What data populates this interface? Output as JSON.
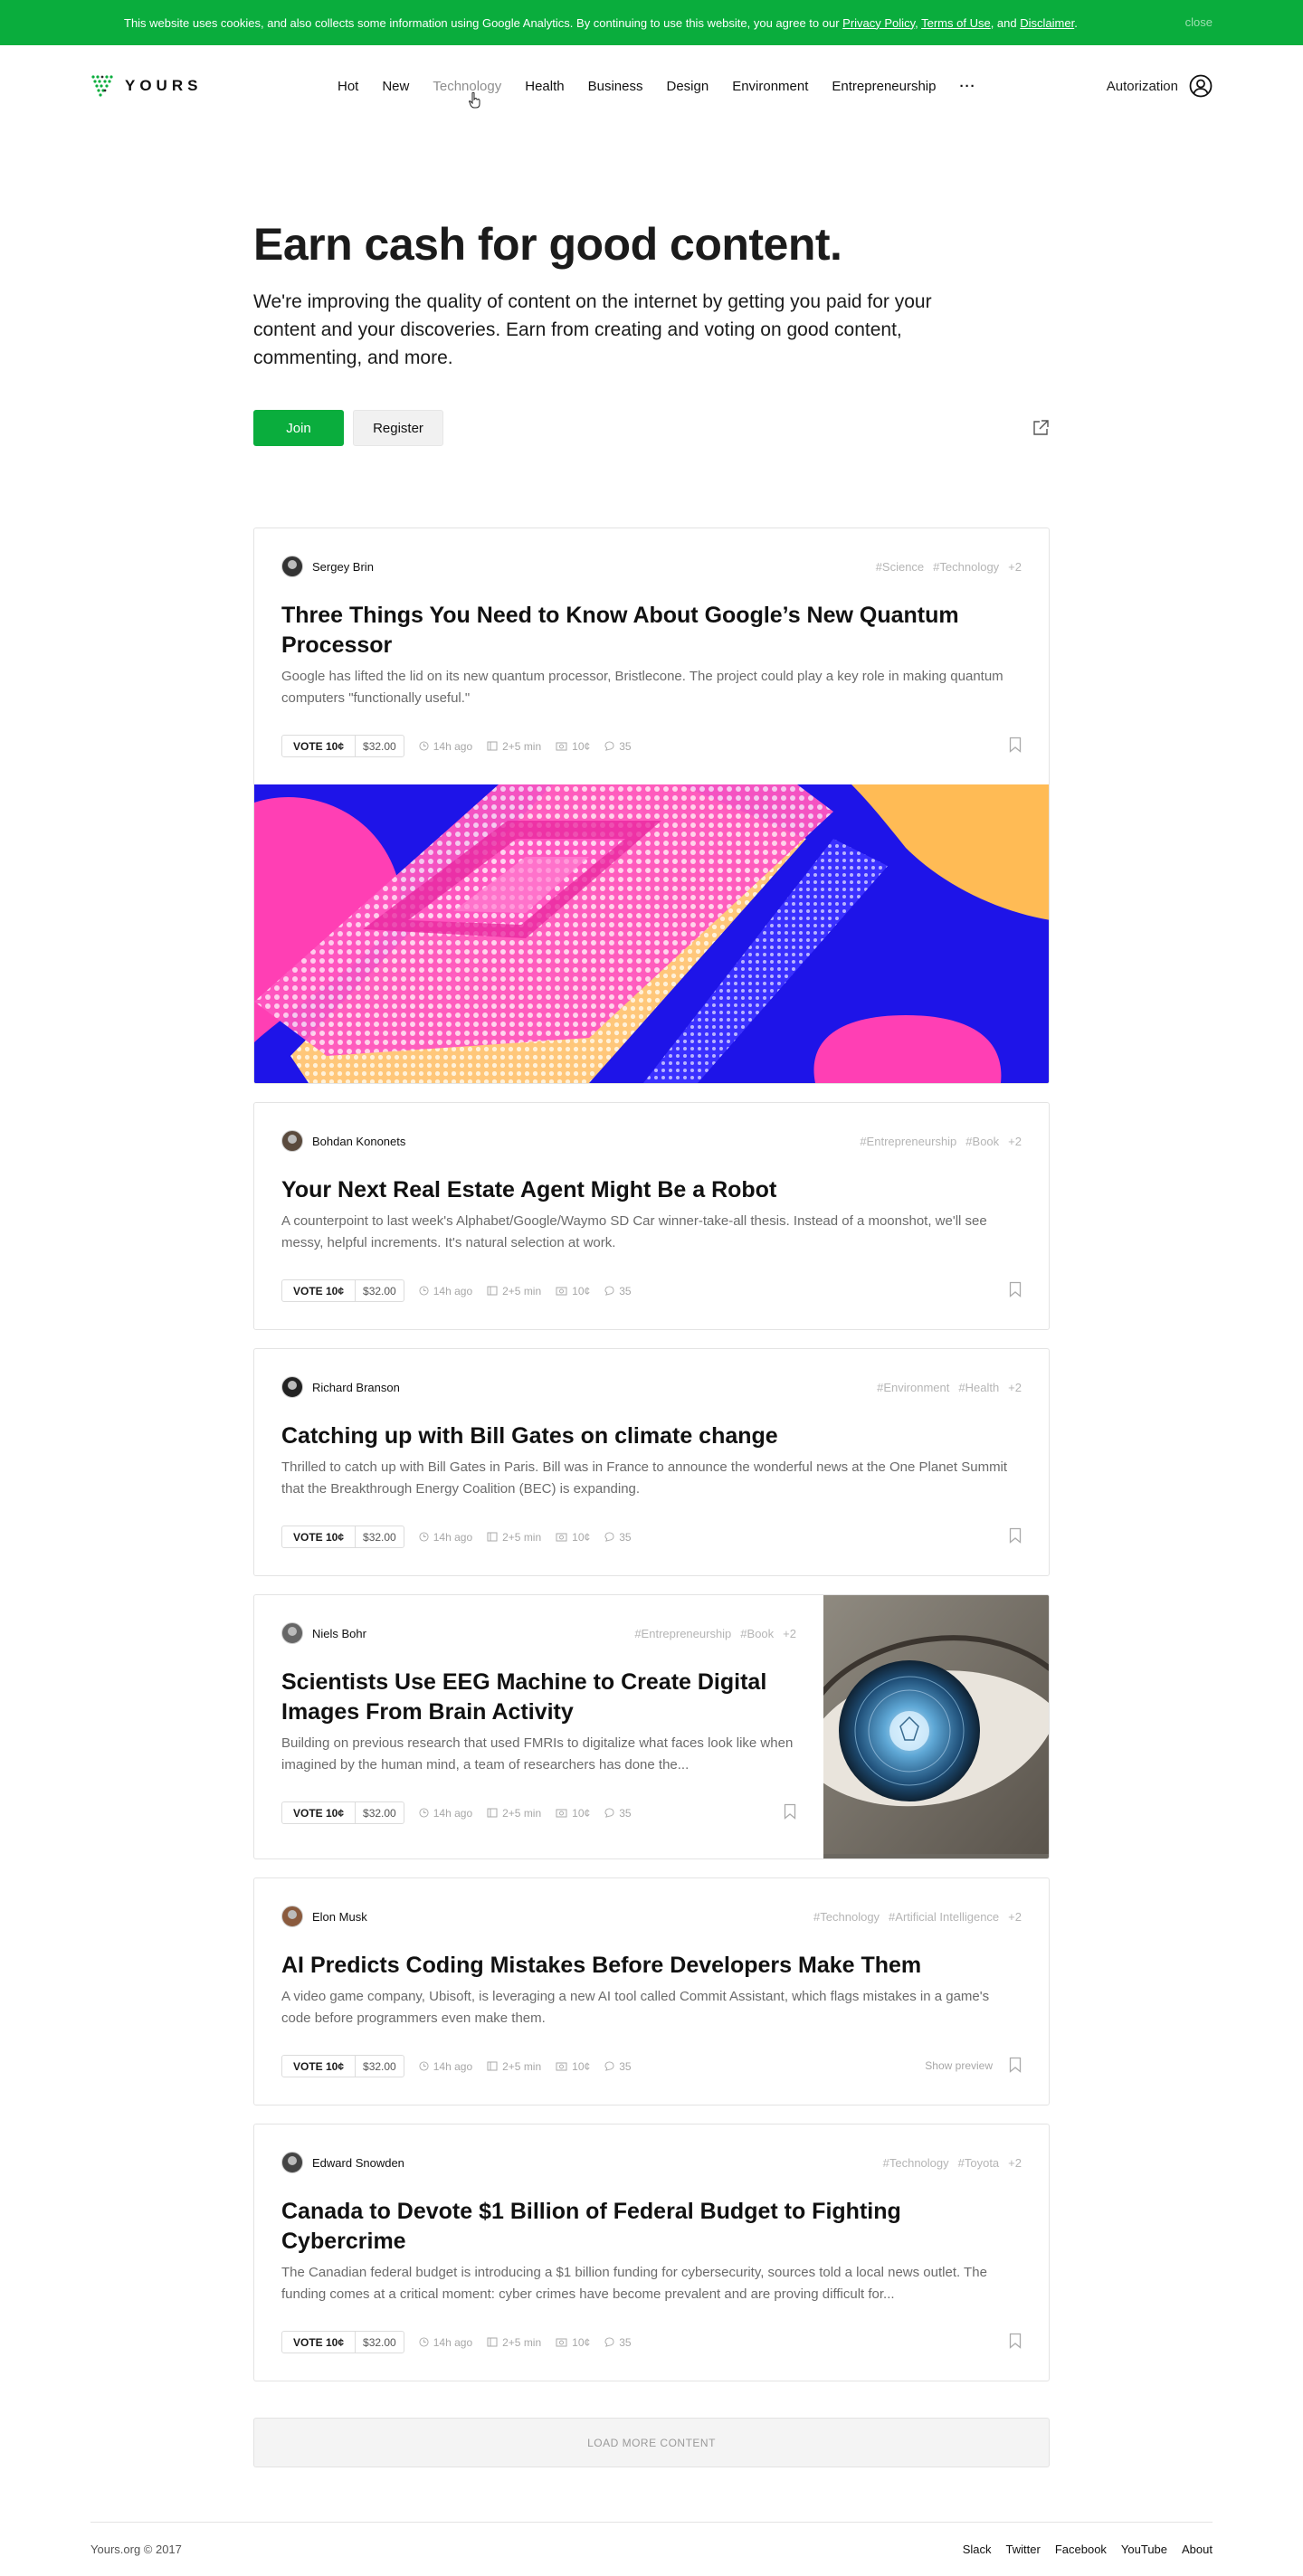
{
  "cookie": {
    "text": "This website uses cookies, and also collects some information using Google Analytics. By continuing to use this website, you agree to our",
    "privacy": "Privacy Policy",
    "terms": "Terms of Use",
    "and": ", and",
    "disclaimer": "Disclaimer",
    "close": "close"
  },
  "header": {
    "logo": "YOURS",
    "nav": [
      "Hot",
      "New",
      "Technology",
      "Health",
      "Business",
      "Design",
      "Environment",
      "Entrepreneurship"
    ],
    "more": "···",
    "auth": "Autorization"
  },
  "hero": {
    "title": "Earn cash for good content.",
    "text": "We're improving the quality of content on the internet by getting you paid for your content and your discoveries. Earn from creating and voting on good content, commenting, and more.",
    "join": "Join",
    "register": "Register"
  },
  "posts": [
    {
      "author": "Sergey Brin",
      "tags": [
        "#Science",
        "#Technology",
        "+2"
      ],
      "title": "Three Things You Need to Know About Google’s New Quantum Processor",
      "desc": "Google has lifted the lid on its new quantum processor, Bristlecone. The project could play a key role in making quantum computers \"functionally useful.\"",
      "vote": "VOTE 10¢",
      "price": "$32.00",
      "time": "14h ago",
      "read": "2+5 min",
      "cost": "10¢",
      "comments": "35"
    },
    {
      "author": "Bohdan Kononets",
      "tags": [
        "#Entrepreneurship",
        "#Book",
        "+2"
      ],
      "title": "Your Next Real Estate Agent Might Be a Robot",
      "desc": "A counterpoint to last week's Alphabet/Google/Waymo SD Car winner-take-all thesis. Instead of a moonshot, we'll see messy, helpful increments. It's natural selection at work.",
      "vote": "VOTE 10¢",
      "price": "$32.00",
      "time": "14h ago",
      "read": "2+5 min",
      "cost": "10¢",
      "comments": "35"
    },
    {
      "author": "Richard Branson",
      "tags": [
        "#Environment",
        "#Health",
        "+2"
      ],
      "title": "Catching up with Bill Gates on climate change",
      "desc": "Thrilled to catch up with Bill Gates in Paris. Bill was in France to announce the wonderful news at the One Planet Summit that the Breakthrough Energy Coalition (BEC) is expanding.",
      "vote": "VOTE 10¢",
      "price": "$32.00",
      "time": "14h ago",
      "read": "2+5 min",
      "cost": "10¢",
      "comments": "35"
    },
    {
      "author": "Niels Bohr",
      "tags": [
        "#Entrepreneurship",
        "#Book",
        "+2"
      ],
      "title": "Scientists Use EEG Machine to Create Digital Images From Brain Activity",
      "desc": "Building on previous research that used FMRIs to digitalize what faces look like when imagined by the human mind, a team of researchers has done the...",
      "vote": "VOTE 10¢",
      "price": "$32.00",
      "time": "14h ago",
      "read": "2+5 min",
      "cost": "10¢",
      "comments": "35"
    },
    {
      "author": "Elon Musk",
      "tags": [
        "#Technology",
        "#Artificial Intelligence",
        "+2"
      ],
      "title": "AI Predicts Coding Mistakes Before Developers Make Them",
      "desc": "A video game company, Ubisoft, is leveraging a new AI tool called Commit Assistant, which flags mistakes in a game's code before programmers even make them.",
      "vote": "VOTE 10¢",
      "price": "$32.00",
      "time": "14h ago",
      "read": "2+5 min",
      "cost": "10¢",
      "comments": "35",
      "preview": "Show preview"
    },
    {
      "author": "Edward Snowden",
      "tags": [
        "#Technology",
        "#Toyota",
        "+2"
      ],
      "title": "Canada to Devote $1 Billion of Federal Budget to Fighting Cybercrime",
      "desc": "The Canadian federal budget is introducing a $1 billion funding for cybersecurity, sources told a local news outlet. The funding comes at a critical moment: cyber crimes have become prevalent and are proving difficult for...",
      "vote": "VOTE 10¢",
      "price": "$32.00",
      "time": "14h ago",
      "read": "2+5 min",
      "cost": "10¢",
      "comments": "35"
    }
  ],
  "load_more": "LOAD MORE CONTENT",
  "footer": {
    "copyright": "Yours.org © 2017",
    "links": [
      "Slack",
      "Twitter",
      "Facebook",
      "YouTube",
      "About"
    ]
  },
  "colors": {
    "accent": "#0aad3d",
    "chip_blue": "#1e14e8",
    "chip_pink": "#ff3fb4",
    "chip_orange": "#ffbb55"
  },
  "icons": [
    "logo-v-icon",
    "user-circle-icon",
    "share-icon",
    "clock-icon",
    "book-icon",
    "coin-icon",
    "comment-icon",
    "bookmark-icon",
    "cursor-icon"
  ]
}
